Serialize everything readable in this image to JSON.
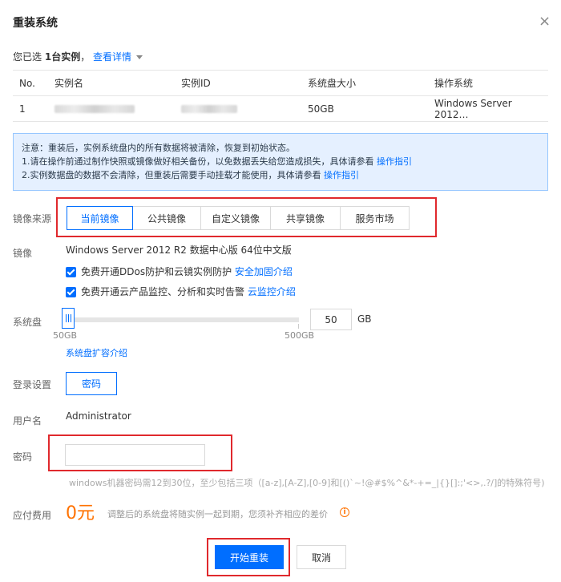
{
  "dialog": {
    "title": "重装系统",
    "close_icon": "×"
  },
  "selection": {
    "prefix": "您已选",
    "count": "1台实例",
    "suffix": "，",
    "detail_link": "查看详情"
  },
  "table": {
    "headers": [
      "No.",
      "实例名",
      "实例ID",
      "系统盘大小",
      "操作系统"
    ],
    "rows": [
      {
        "no": "1",
        "name": "",
        "id": "",
        "disk": "50GB",
        "os": "Windows Server 2012…"
      }
    ]
  },
  "notice": {
    "line1": "注意：重装后，实例系统盘内的所有数据将被清除，恢复到初始状态。",
    "line2_text": "1.请在操作前通过制作快照或镜像做好相关备份，以免数据丢失给您造成损失，具体请参看",
    "line2_link": "操作指引",
    "line3_text": "2.实例数据盘的数据不会清除，但重装后需要手动挂载才能使用，具体请参看",
    "line3_link": "操作指引"
  },
  "image_source": {
    "label": "镜像来源",
    "tabs": [
      "当前镜像",
      "公共镜像",
      "自定义镜像",
      "共享镜像",
      "服务市场"
    ],
    "active_index": 0
  },
  "image": {
    "label": "镜像",
    "value": "Windows Server 2012 R2 数据中心版 64位中文版",
    "option1_text": "免费开通DDos防护和云镜实例防护",
    "option1_link": "安全加固介绍",
    "option2_text": "免费开通云产品监控、分析和实时告警",
    "option2_link": "云监控介绍"
  },
  "system_disk": {
    "label": "系统盘",
    "min_label": "50GB",
    "max_label": "500GB",
    "value": "50",
    "unit": "GB",
    "slider_fraction": 0.0,
    "expand_link": "系统盘扩容介绍"
  },
  "login": {
    "label": "登录设置",
    "method": "密码",
    "username_label": "用户名",
    "username": "Administrator",
    "password_label": "密码",
    "password_value": "",
    "password_hint": "windows机器密码需12到30位，至少包括三项（[a-z],[A-Z],[0-9]和[()`~!@#$%^&*-+=_|{}[]:;'<>,.?/]的特殊符号)"
  },
  "fee": {
    "label": "应付费用",
    "amount": "0元",
    "description": "调整后的系统盘将随实例一起到期，您须补齐相应的差价",
    "info_icon": "i"
  },
  "actions": {
    "confirm": "开始重装",
    "cancel": "取消"
  },
  "colors": {
    "accent": "#006eff",
    "highlight": "#e0292d",
    "fee": "#ff7200",
    "notice_bg": "#e5f0ff"
  }
}
